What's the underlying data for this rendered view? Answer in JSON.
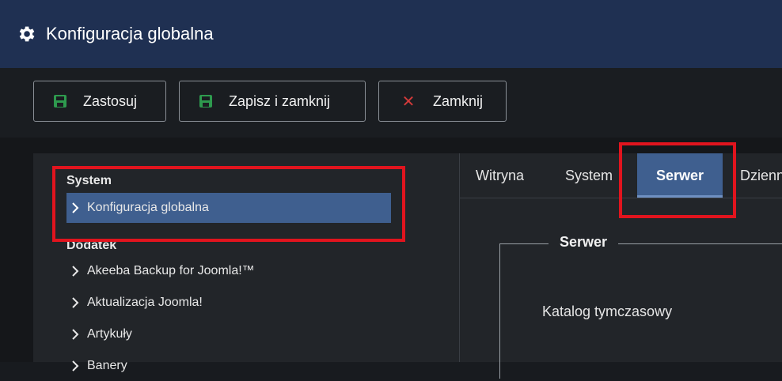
{
  "header": {
    "title": "Konfiguracja globalna",
    "icon": "gear-icon"
  },
  "toolbar": {
    "apply_label": "Zastosuj",
    "save_close_label": "Zapisz i zamknij",
    "close_label": "Zamknij",
    "save_icon_color": "#2e9a4e",
    "close_icon_color": "#d23a3a"
  },
  "sidebar": {
    "sections": [
      {
        "heading": "System",
        "items": [
          {
            "label": "Konfiguracja globalna",
            "active": true
          }
        ]
      },
      {
        "heading": "Dodatek",
        "items": [
          {
            "label": "Akeeba Backup for Joomla!™"
          },
          {
            "label": "Aktualizacja Joomla!"
          },
          {
            "label": "Artykuły"
          },
          {
            "label": "Banery"
          }
        ]
      }
    ]
  },
  "tabs": [
    {
      "label": "Witryna"
    },
    {
      "label": "System"
    },
    {
      "label": "Serwer",
      "active": true
    },
    {
      "label": "Dziennik"
    }
  ],
  "panel": {
    "legend": "Serwer",
    "field_label": "Katalog tymczasowy"
  },
  "colors": {
    "header_bg": "#1f3052",
    "active_bg": "#3f5f8f",
    "highlight_box": "#e1141e"
  }
}
